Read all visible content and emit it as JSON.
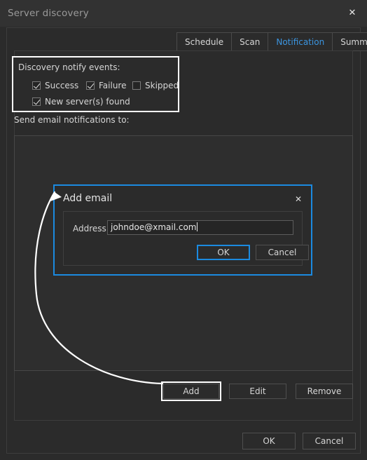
{
  "window": {
    "title": "Server discovery",
    "close_icon": "close-icon",
    "close_glyph": "✕"
  },
  "tabs": [
    {
      "label": "Schedule",
      "active": false
    },
    {
      "label": "Scan",
      "active": false
    },
    {
      "label": "Notification",
      "active": true
    },
    {
      "label": "Summary",
      "active": false
    }
  ],
  "notify_group": {
    "label": "Discovery notify events:",
    "checkboxes": [
      {
        "label": "Success",
        "checked": true
      },
      {
        "label": "Failure",
        "checked": true
      },
      {
        "label": "Skipped",
        "checked": false
      },
      {
        "label": "New server(s) found",
        "checked": true
      }
    ]
  },
  "recipients": {
    "label": "Send email notifications to:",
    "items": [],
    "buttons": {
      "add": "Add",
      "edit": "Edit",
      "remove": "Remove"
    }
  },
  "footer": {
    "ok": "OK",
    "cancel": "Cancel"
  },
  "modal": {
    "title": "Add email",
    "close_glyph": "✕",
    "address_label": "Address:",
    "address_value": "johndoe@xmail.com",
    "address_placeholder": "",
    "ok": "OK",
    "cancel": "Cancel"
  },
  "colors": {
    "accent_blue": "#1b8ae0",
    "tab_active_text": "#3b95e0",
    "highlight_white": "#ffffff",
    "window_bg": "#2b2b2b",
    "titlebar_bg": "#323232",
    "text": "#d6d6d6"
  }
}
